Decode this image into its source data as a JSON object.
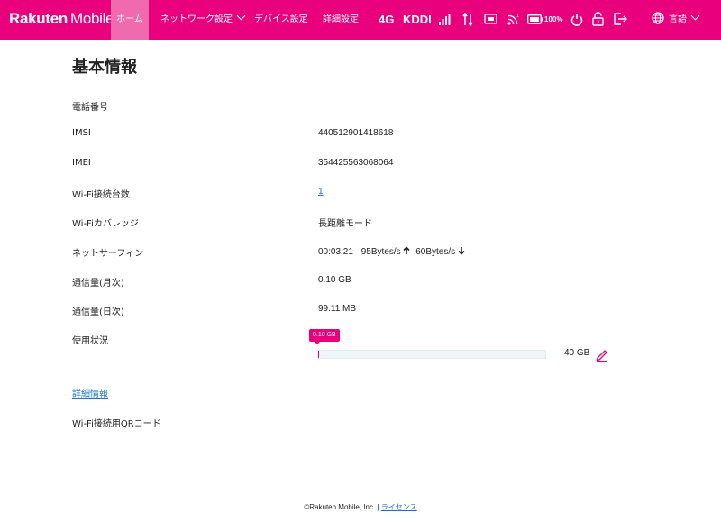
{
  "header": {
    "brand_main": "Rakuten",
    "brand_sub": "Mobile",
    "nav": [
      {
        "label": "ホーム",
        "active": true
      },
      {
        "label": "ネットワーク設定",
        "has_dropdown": true
      },
      {
        "label": "デバイス設定"
      },
      {
        "label": "詳細設定"
      }
    ],
    "status": {
      "network_type": "4G",
      "carrier": "KDDI",
      "battery": "100%",
      "icons": [
        "signal-bars-icon",
        "data-transfer-icon",
        "sim-icon",
        "wifi-icon",
        "battery-icon",
        "power-icon",
        "lock-icon",
        "logout-icon"
      ]
    },
    "language": {
      "label": "言語",
      "icon": "globe-icon"
    }
  },
  "page": {
    "title": "基本情報",
    "rows": [
      {
        "label": "電話番号",
        "value": ""
      },
      {
        "label": "IMSI",
        "value": "440512901418618"
      },
      {
        "label": "IMEI",
        "value": "354425563068064"
      },
      {
        "label": "Wi-Fi接続台数",
        "value": "1"
      },
      {
        "label": "Wi-Fiカバレッジ",
        "value": "長距離モード"
      },
      {
        "label": "ネットサーフィン",
        "time": "00:03:21",
        "upload": "95Bytes/s",
        "download": "60Bytes/s"
      },
      {
        "label": "通信量(月次)",
        "value": "0.10 GB"
      },
      {
        "label": "通信量(日次)",
        "value": "99.11 MB"
      },
      {
        "label": "使用状況"
      }
    ],
    "usage": {
      "used_label": "0.10 GB",
      "capacity": "40 GB",
      "used_fraction": 0.0025
    },
    "details_link": "詳細情報",
    "qr_label": "Wi-Fi接続用QRコード"
  },
  "footer": {
    "copyright": "©Rakuten Mobile, Inc.",
    "separator": "|",
    "license_link": "ライセンス"
  },
  "colors": {
    "brand": "#e8007d",
    "nav_active": "#f06aaf",
    "link": "#1a73c9"
  }
}
